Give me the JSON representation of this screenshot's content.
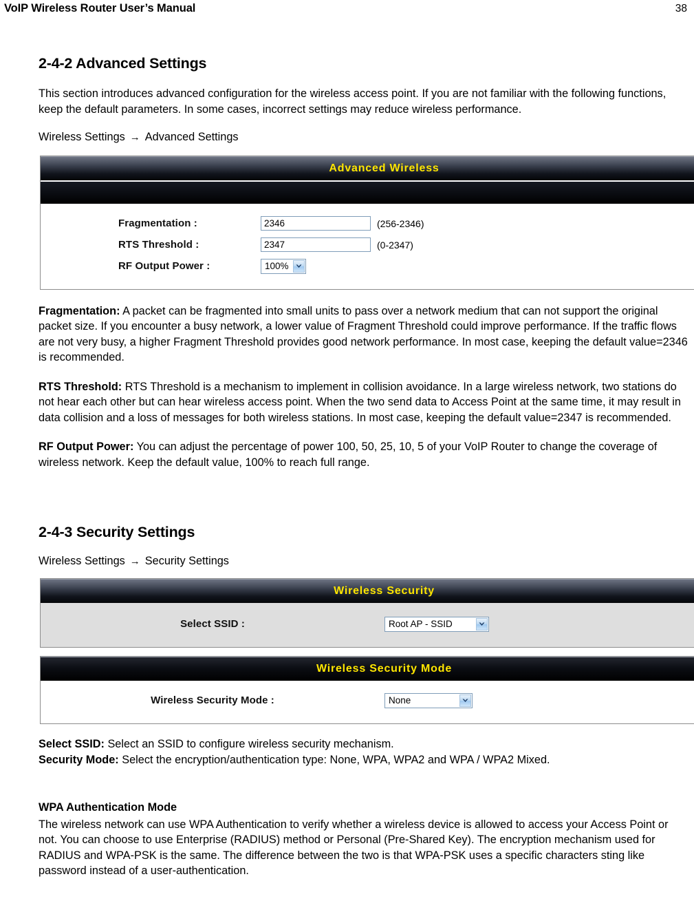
{
  "header": {
    "title": "VoIP Wireless Router User’s Manual",
    "page_number": "38"
  },
  "sections": {
    "advanced": {
      "heading": "2-4-2 Advanced Settings",
      "intro": "This section introduces advanced configuration for the wireless access point. If you are not familiar with the following functions, keep the default parameters. In some cases, incorrect settings may reduce wireless performance.",
      "breadcrumb": {
        "from": "Wireless Settings",
        "arrow": "→",
        "to": "Advanced Settings"
      },
      "screenshot": {
        "panel_title": "Advanced Wireless",
        "rows": [
          {
            "label": "Fragmentation :",
            "control": "text",
            "value": "2346",
            "hint": "(256-2346)"
          },
          {
            "label": "RTS Threshold :",
            "control": "text",
            "value": "2347",
            "hint": "(0-2347)"
          },
          {
            "label": "RF Output Power :",
            "control": "select",
            "value": "100%",
            "hint": ""
          }
        ]
      },
      "definitions": [
        {
          "term": "Fragmentation:",
          "text": " A packet can be fragmented into small units to pass over a network medium that can not support the original packet size. If you encounter a busy network, a lower value of Fragment Threshold could improve performance. If the traffic flows are not very busy, a higher Fragment Threshold provides good network performance. In most case, keeping the default value=2346 is recommended."
        },
        {
          "term": "RTS Threshold:",
          "text": " RTS Threshold is a mechanism to implement in collision avoidance. In a large wireless network, two stations do not hear each other but can hear wireless access point. When the two send data to Access Point at the same time, it may result in data collision and a loss of messages for both wireless stations. In most case, keeping the default value=2347 is recommended."
        },
        {
          "term": "RF Output Power:",
          "text": " You can adjust the percentage of power 100, 50, 25, 10, 5 of your VoIP Router to change the coverage of wireless network. Keep the default value, 100% to reach full range."
        }
      ]
    },
    "security": {
      "heading": "2-4-3 Security Settings",
      "breadcrumb": {
        "from": "Wireless Settings",
        "arrow": "→",
        "to": "Security Settings"
      },
      "screenshot_ssid": {
        "panel_title": "Wireless Security",
        "row": {
          "label": "Select SSID :",
          "value": "Root AP - SSID"
        }
      },
      "screenshot_mode": {
        "panel_title": "Wireless Security Mode",
        "row": {
          "label": "Wireless Security Mode :",
          "value": "None"
        }
      },
      "definitions": [
        {
          "term": "Select SSID:",
          "text": " Select an SSID to configure wireless security mechanism."
        },
        {
          "term": "Security Mode:",
          "text": " Select the encryption/authentication type: None, WPA, WPA2 and WPA / WPA2 Mixed."
        }
      ],
      "wpa": {
        "subheading": "WPA Authentication Mode",
        "text": "The wireless network can use WPA Authentication to verify whether a wireless device is allowed to access your Access Point or not. You can choose to use Enterprise (RADIUS) method or Personal (Pre-Shared Key). The encryption mechanism used for RADIUS and WPA-PSK is the same. The difference between the two is that WPA-PSK uses a specific characters sting like password instead of a user-authentication."
      }
    }
  },
  "colors": {
    "panel_title_text": "#ffe600",
    "panel_border": "#8c8c8c",
    "panel_body_grey": "#dedede",
    "input_border": "#7f9db9"
  }
}
